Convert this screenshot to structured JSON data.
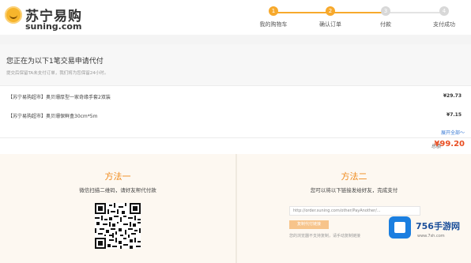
{
  "header": {
    "logo_cn": "苏宁易购",
    "logo_en": "suning.com",
    "steps": [
      {
        "num": "1",
        "label": "我的购物车",
        "status": "done"
      },
      {
        "num": "2",
        "label": "确认订单",
        "status": "done"
      },
      {
        "num": "3",
        "label": "付款",
        "status": "todo"
      },
      {
        "num": "4",
        "label": "支付成功",
        "status": "todo"
      }
    ]
  },
  "request": {
    "title": "您正在为以下1笔交易申请代付",
    "subtitle": "提交后保留TA未支付订单，我们将为您保留24小时。",
    "items": [
      {
        "name": "【苏宁易购超市】奥贝珊厚型一家奇缘手套2双装",
        "price": "¥29.73"
      },
      {
        "name": "【苏宁易购超市】奥贝珊保鲜盒30cm*5m",
        "price": "¥7.15"
      }
    ],
    "expand": "展开全部～",
    "total_label": "总额",
    "total_value": "¥99.20"
  },
  "methods": {
    "one": {
      "title": "方法一",
      "desc": "微信扫描二维码，请好友帮代付款"
    },
    "two": {
      "title": "方法二",
      "desc": "您可以将以下链接发给好友，完成支付",
      "link": "http://order.suning.com/other/PayAnother/...",
      "copy_button": "复制代付链接",
      "note": "您的浏览器不支持复制，请手动复制链接"
    }
  },
  "watermark": {
    "brand": "756手游网",
    "url": "www.7sh.com"
  }
}
